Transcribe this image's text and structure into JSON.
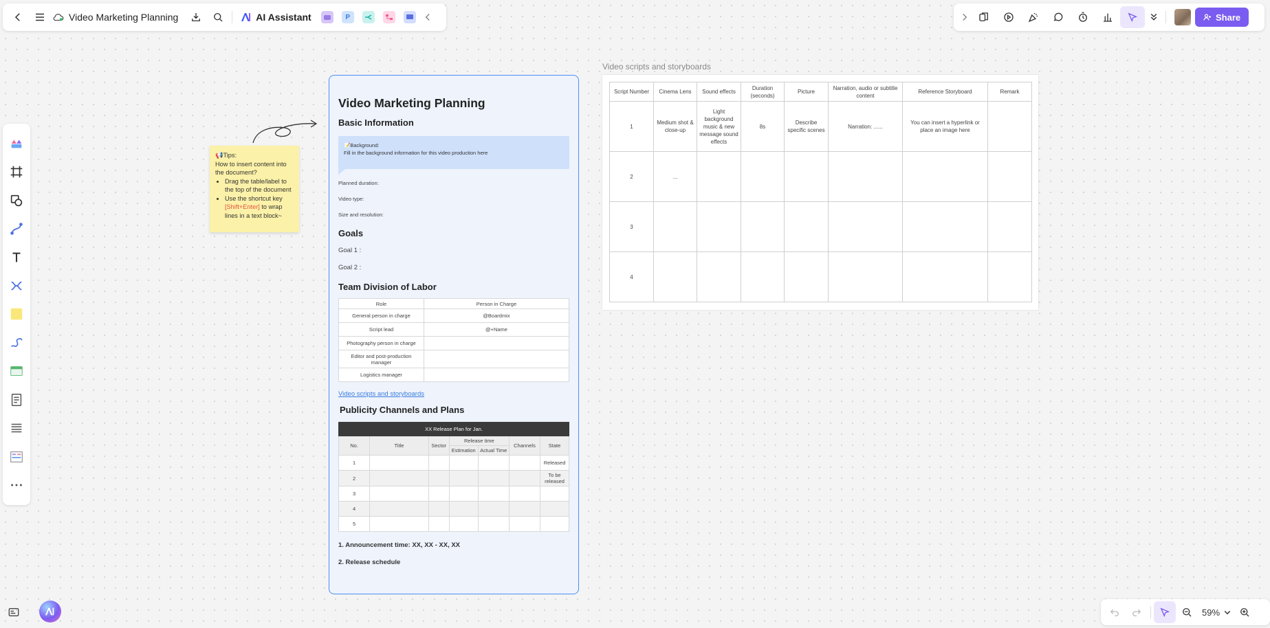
{
  "toolbar": {
    "doc_title": "Video Marketing Planning",
    "ai_label": "AI Assistant"
  },
  "share": {
    "label": "Share",
    "accent": "#7b5cf0"
  },
  "zoom": {
    "level": "59%"
  },
  "sticky": {
    "title": "Tips:",
    "question": "How to insert content into the document?",
    "tip1": "Drag the table/label to the top of the document",
    "tip2_prefix": "Use the shortcut key ",
    "tip2_key": "[Shift+Enter]",
    "tip2_suffix": " to wrap lines in a text block~"
  },
  "doc": {
    "title": "Video Marketing Planning",
    "basic_info": "Basic Information",
    "background_label": "Background:",
    "background_text": "Fill in the background information for this video production here",
    "planned_duration": "Planned duration:",
    "video_type": "Video type:",
    "size_resolution": "Size and resolution:",
    "goals": "Goals",
    "goal1": "Goal 1 :",
    "goal2": "Goal 2 :",
    "team_heading": "Team Division of Labor",
    "team_headers": [
      "Role",
      "Person in Charge"
    ],
    "team_rows": [
      [
        "General person in charge",
        "@Boardmix"
      ],
      [
        "Script lead",
        "@+Name"
      ],
      [
        "Photography person in charge",
        ""
      ],
      [
        "Editor and post-production manager",
        ""
      ],
      [
        "Logistics manager",
        ""
      ]
    ],
    "storyboard_link": "Video scripts and storyboards",
    "publicity_heading": "Publicity Channels and Plans",
    "release_title": "XX Release Plan for Jan.",
    "release_headers": {
      "no": "No.",
      "title": "Title",
      "sector": "Sector",
      "release_time": "Release time",
      "estimation": "Estimation",
      "actual": "Actual Time",
      "channels": "Channels",
      "state": "State"
    },
    "release_rows": [
      [
        "1",
        "Released"
      ],
      [
        "2",
        "To be released"
      ],
      [
        "3",
        ""
      ],
      [
        "4",
        ""
      ],
      [
        "5",
        ""
      ]
    ],
    "announcement": "1. Announcement time: XX, XX - XX, XX",
    "release_schedule": "2. Release schedule"
  },
  "storyboard": {
    "title": "Video scripts and storyboards",
    "headers": [
      "Script Number",
      "Cinema Lens",
      "Sound effects",
      "Duration (seconds)",
      "Picture",
      "Narration, audio or subtitle content",
      "Reference Storyboard",
      "Remark"
    ],
    "rows": [
      [
        "1",
        "Medium shot & close-up",
        "Light background music & new message sound effects",
        "8s",
        "Describe specific scenes",
        "Narration: ......",
        "You can insert a hyperlink or place an image here",
        ""
      ],
      [
        "2",
        "...",
        "",
        "",
        "",
        "",
        "",
        ""
      ],
      [
        "3",
        "",
        "",
        "",
        "",
        "",
        "",
        ""
      ],
      [
        "4",
        "",
        "",
        "",
        "",
        "",
        "",
        ""
      ]
    ]
  }
}
